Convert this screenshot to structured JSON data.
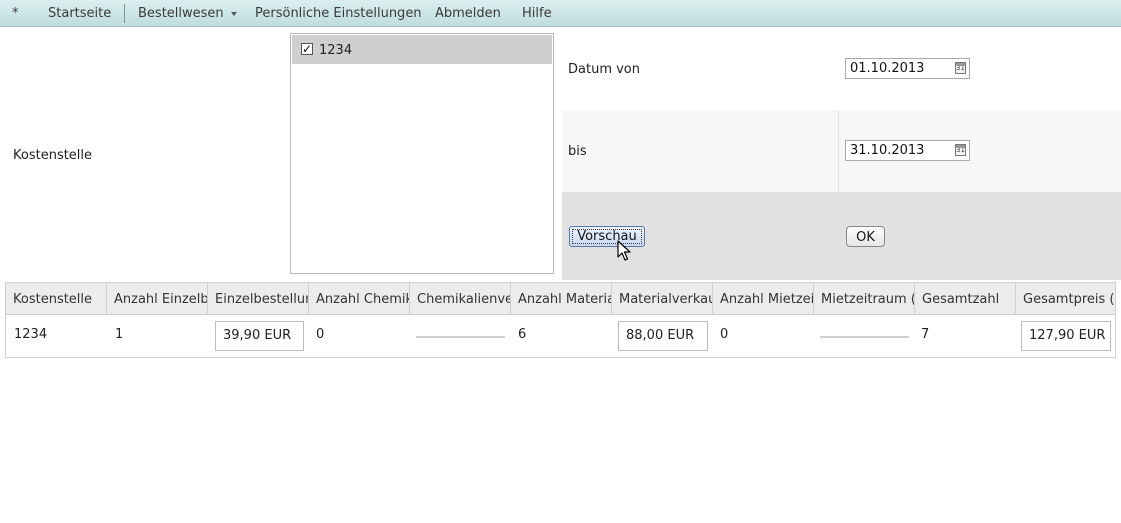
{
  "menu": {
    "star": "*",
    "home": "Startseite",
    "orders": "Bestellwesen",
    "settings": "Persönliche Einstellungen",
    "logout": "Abmelden",
    "help": "Hilfe"
  },
  "filter": {
    "cost_center_label": "Kostenstelle",
    "cost_center_options": [
      {
        "label": "1234",
        "checked": true
      }
    ],
    "date_from_label": "Datum von",
    "date_from_value": "01.10.2013",
    "date_to_label": "bis",
    "date_to_value": "31.10.2013",
    "calendar_icon_text": "31",
    "preview_button": "Vorschau",
    "ok_button": "OK"
  },
  "table": {
    "columns": [
      "Kostenstelle",
      "Anzahl Einzelbestellungen",
      "Einzelbestellungen",
      "Anzahl Chemikalien",
      "Chemikalienverkauf",
      "Anzahl Materialverkauf",
      "Materialverkauf",
      "Anzahl Mietzeitraum",
      "Mietzeitraum (ca.)",
      "Gesamtzahl",
      "Gesamtpreis (ca.)"
    ],
    "rows": [
      {
        "cost_center": "1234",
        "single_orders_count": "1",
        "single_orders_price": "39,90 EUR",
        "chemicals_count": "0",
        "chemicals_price": "",
        "materials_count": "6",
        "materials_price": "88,00 EUR",
        "rental_count": "0",
        "rental_price": "",
        "total_count": "7",
        "total_price": "127,90 EUR"
      }
    ]
  }
}
